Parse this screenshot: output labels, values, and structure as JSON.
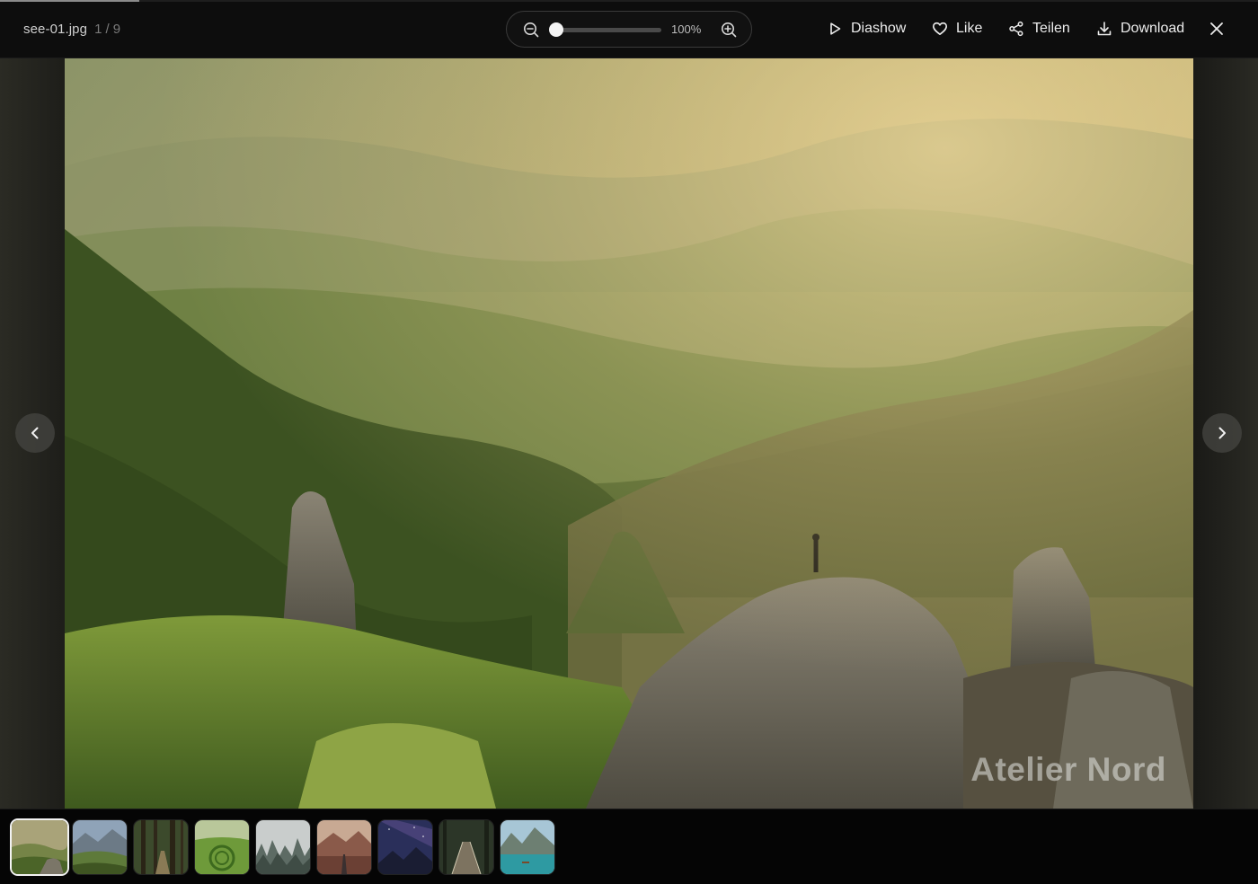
{
  "slideshow": {
    "progress": 0.111
  },
  "file": {
    "name": "see-01.jpg",
    "index": "1",
    "separator": "/",
    "total": "9"
  },
  "zoom": {
    "value_label": "100%",
    "level_fraction": 0.0,
    "out_icon": "zoom-out-icon",
    "in_icon": "zoom-in-icon"
  },
  "actions": {
    "slideshow": "Diashow",
    "like": "Like",
    "share": "Teilen",
    "download": "Download"
  },
  "icons": {
    "slideshow": "play-icon",
    "like": "heart-icon",
    "share": "share-icon",
    "download": "download-icon",
    "close": "close-icon",
    "prev": "chevron-left-icon",
    "next": "chevron-right-icon"
  },
  "photo": {
    "watermark": "Atelier Nord"
  },
  "thumbnails": [
    {
      "scene": "misty-mountains",
      "active": true
    },
    {
      "scene": "mountain-valley",
      "active": false
    },
    {
      "scene": "forest-path",
      "active": false
    },
    {
      "scene": "green-field",
      "active": false
    },
    {
      "scene": "foggy-forest",
      "active": false
    },
    {
      "scene": "desert-road",
      "active": false
    },
    {
      "scene": "night-sky-mountain",
      "active": false
    },
    {
      "scene": "forest-bridge",
      "active": false
    },
    {
      "scene": "mountain-lake",
      "active": false
    }
  ],
  "colors": {
    "background": "#0b0b0b",
    "text": "#ececec",
    "muted": "#7a7a7a",
    "accent": "#f2f2f2"
  }
}
